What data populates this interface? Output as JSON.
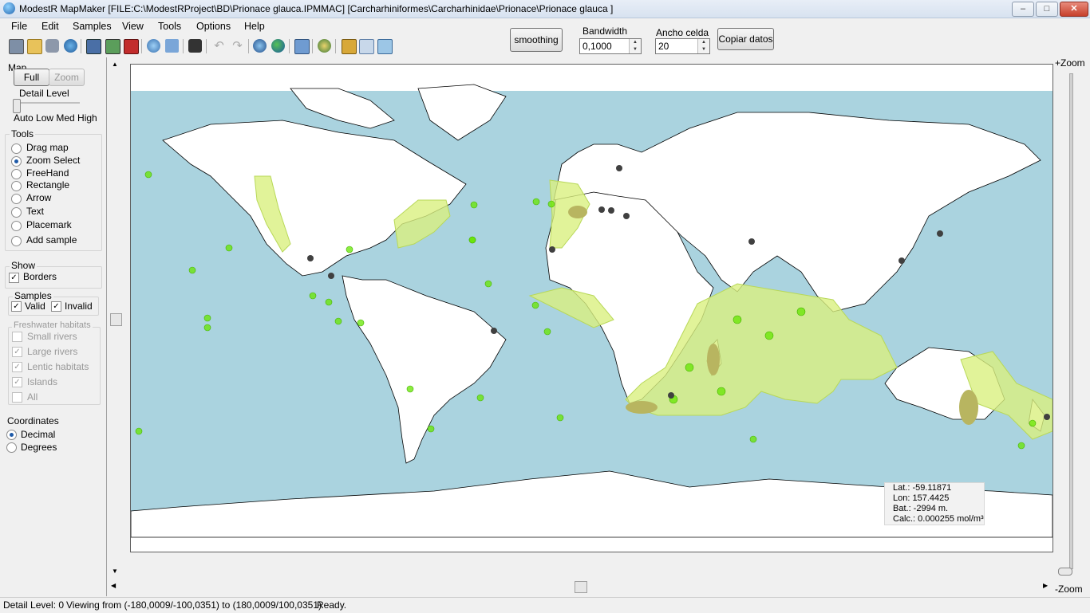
{
  "window": {
    "title": "ModestR MapMaker [FILE:C:\\ModestRProject\\BD\\Prionace glauca.IPMMAC] [Carcharhiniformes\\Carcharhinidae\\Prionace\\Prionace glauca ]",
    "controls": {
      "minimize": "–",
      "maximize": "□",
      "close": "✕"
    }
  },
  "menu": [
    "File",
    "Edit",
    "Samples",
    "View",
    "Tools",
    "Options",
    "Help"
  ],
  "toolbar": {
    "icons": [
      "new-map-icon",
      "open-folder-icon",
      "import-icon",
      "globe-db-icon",
      "save-icon",
      "save-samples-icon",
      "save-red-icon",
      "export-map-icon",
      "export-image-icon",
      "camera-icon",
      "undo-icon",
      "redo-icon",
      "search-globe-icon",
      "earth-icon",
      "options-icon",
      "layers-icon",
      "edit-samples-icon",
      "select-tool-icon",
      "export-arrow-icon"
    ],
    "smoothing_label": "smoothing",
    "bandwidth_label": "Bandwidth",
    "bandwidth_value": "0,1000",
    "cell_label": "Ancho celda",
    "cell_value": "20",
    "copy_label": "Copiar datos"
  },
  "panel": {
    "map": {
      "title": "Map",
      "full": "Full",
      "zoom": "Zoom",
      "detail_label": "Detail Level",
      "levels": "Auto Low Med High"
    },
    "tools": {
      "title": "Tools",
      "items": [
        "Drag map",
        "Zoom Select",
        "FreeHand",
        "Rectangle",
        "Arrow",
        "Text",
        "Placemark",
        "Add sample"
      ],
      "selected": "Zoom Select"
    },
    "show": {
      "title": "Show",
      "borders": "Borders"
    },
    "samples": {
      "title": "Samples",
      "valid": "Valid",
      "invalid": "Invalid"
    },
    "freshwater": {
      "title": "Freshwater habitats",
      "items": [
        {
          "label": "Small rivers",
          "checked": false
        },
        {
          "label": "Large rivers",
          "checked": true
        },
        {
          "label": "Lentic habitats",
          "checked": true
        },
        {
          "label": "Islands",
          "checked": true
        },
        {
          "label": "All",
          "checked": false
        }
      ]
    },
    "coordinates": {
      "title": "Coordinates",
      "options": [
        "Decimal",
        "Degrees"
      ],
      "selected": "Decimal"
    }
  },
  "zoom": {
    "plus": "+Zoom",
    "minus": "-Zoom"
  },
  "map_info": {
    "lat": "Lat.: -59.11871",
    "lon": "Lon: 157.4425",
    "bat": "Bat.: -2994 m.",
    "calc": "Calc.: 0.000255 mol/m³"
  },
  "colors": {
    "ocean": "#aad3df",
    "land": "#ffffff",
    "density": "#d9f080",
    "density_core": "#b8b560",
    "valid_sample": "#66e600",
    "invalid_sample": "#404040"
  },
  "status": {
    "detail": "Detail Level: 0",
    "viewing": "Viewing from (-180,0009/-100,0351) to (180,0009/100,0351)",
    "state": "Ready."
  }
}
